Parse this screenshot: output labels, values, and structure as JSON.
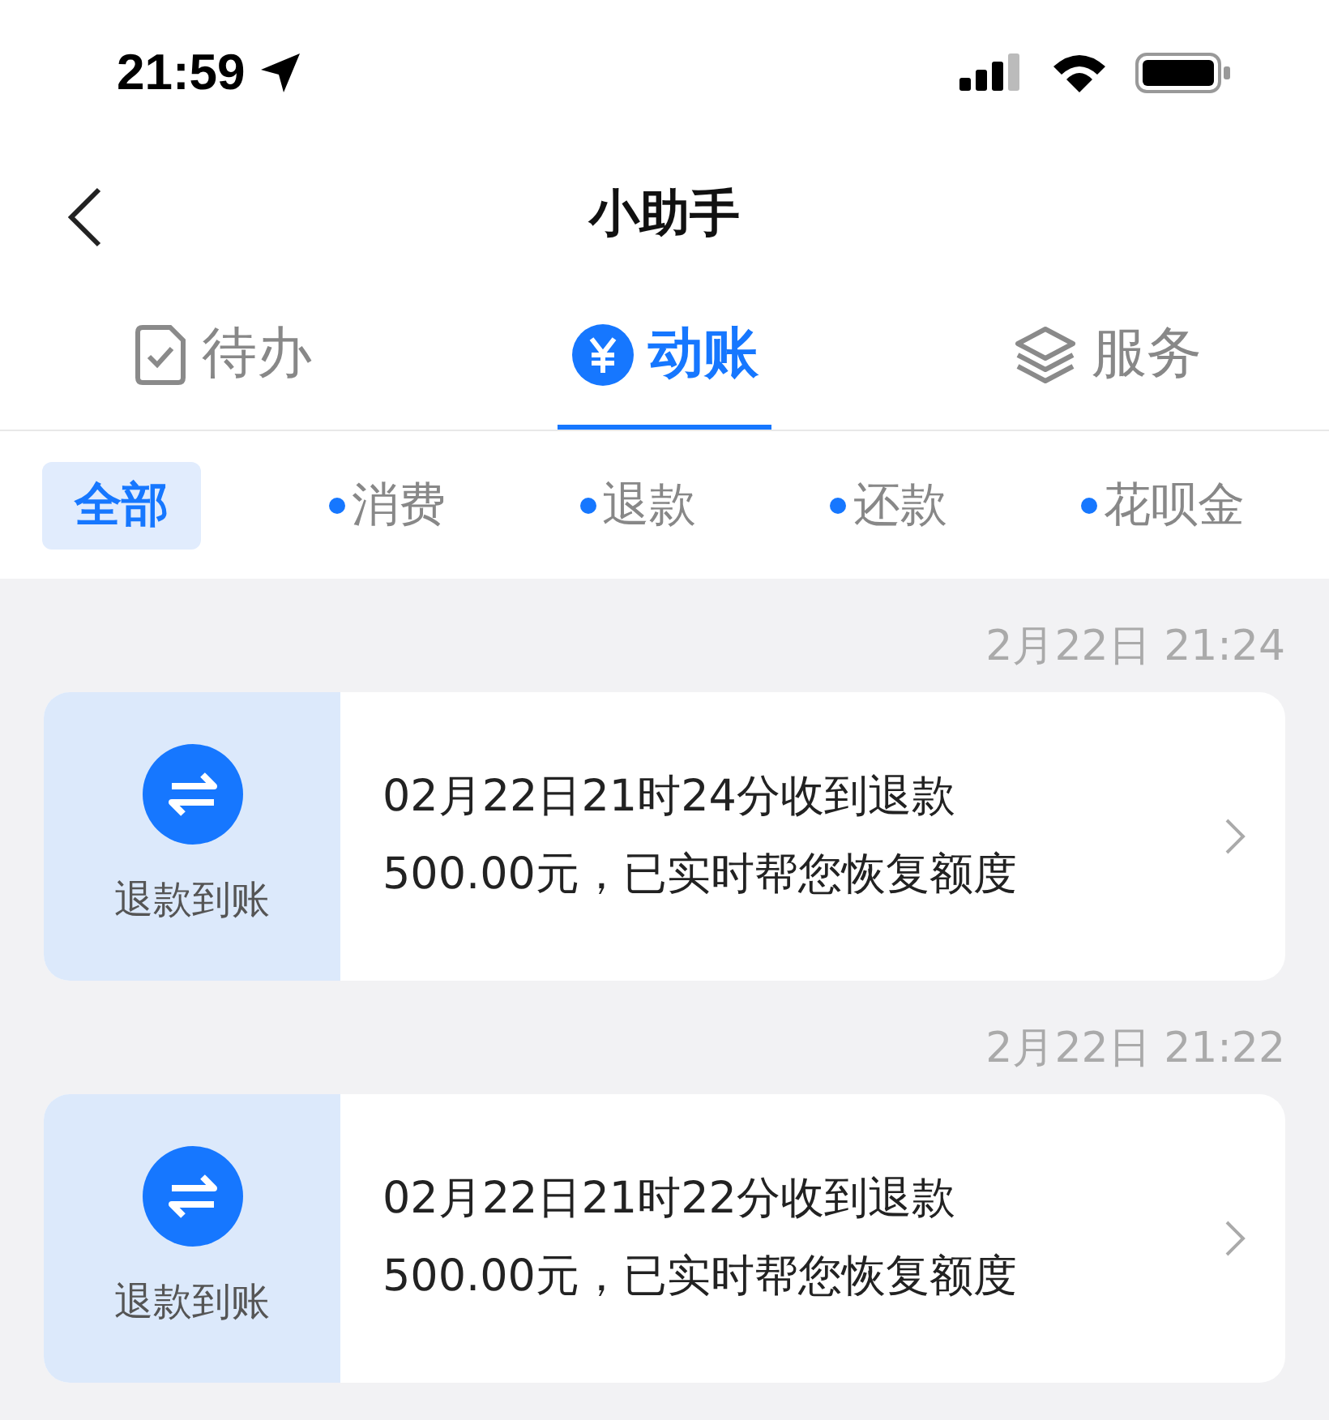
{
  "status_bar": {
    "time": "21:59"
  },
  "header": {
    "title": "小助手"
  },
  "tabs": [
    {
      "label": "待办",
      "selected": false
    },
    {
      "label": "动账",
      "selected": true
    },
    {
      "label": "服务",
      "selected": false
    }
  ],
  "filters": [
    {
      "label": "全部",
      "selected": true
    },
    {
      "label": "消费",
      "selected": false
    },
    {
      "label": "退款",
      "selected": false
    },
    {
      "label": "还款",
      "selected": false
    },
    {
      "label": "花呗金",
      "selected": false
    }
  ],
  "messages": [
    {
      "time": "2月22日 21:24",
      "badge": "退款到账",
      "text": "02月22日21时24分收到退款\n500.00元，已实时帮您恢复额度"
    },
    {
      "time": "2月22日 21:22",
      "badge": "退款到账",
      "text": "02月22日21时22分收到退款\n500.00元，已实时帮您恢复额度"
    }
  ]
}
